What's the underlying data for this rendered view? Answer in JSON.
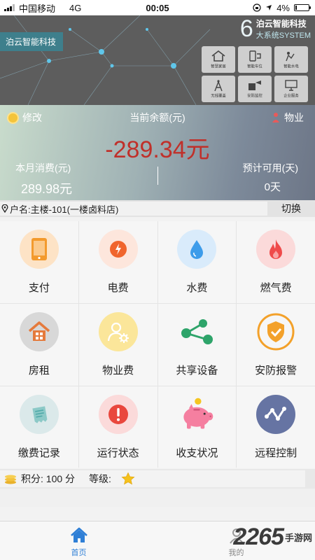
{
  "status_bar": {
    "carrier": "中国移动",
    "network": "4G",
    "time": "00:05",
    "battery": "4%"
  },
  "banner": {
    "tag": "泊云智能科技",
    "brand_number": "6",
    "brand_name": "泊云智能科技",
    "brand_sub": "大系统SYSTEM",
    "tiles": [
      {
        "label": "智慧家居",
        "icon": "house-icon"
      },
      {
        "label": "智能车位",
        "icon": "parking-phone-icon"
      },
      {
        "label": "智能水电",
        "icon": "water-power-icon"
      },
      {
        "label": "无线覆盖",
        "icon": "wireless-tower-icon"
      },
      {
        "label": "安防监控",
        "icon": "camera-icon"
      },
      {
        "label": "企业服务",
        "icon": "computer-icon"
      }
    ]
  },
  "balance": {
    "edit_label": "修改",
    "current_label": "当前余额(元)",
    "amount": "-289.34元",
    "property_label": "物业",
    "month_label": "本月消费(元)",
    "month_value": "289.98元",
    "available_label": "预计可用(天)",
    "available_value": "0天"
  },
  "account": {
    "name": "户名:主楼-101(一楼卤料店)",
    "switch_label": "切换"
  },
  "grid": [
    {
      "label": "支付",
      "icon": "phone-payment-icon",
      "bg": "#fde3c6",
      "fg": "#f39a2d"
    },
    {
      "label": "电费",
      "icon": "lightning-icon",
      "bg": "#fde6dc",
      "fg": "#f0652d"
    },
    {
      "label": "水费",
      "icon": "water-drop-icon",
      "bg": "#d9ebfb",
      "fg": "#3d9cea"
    },
    {
      "label": "燃气费",
      "icon": "flame-icon",
      "bg": "#fbdada",
      "fg": "#ef4b4b"
    },
    {
      "label": "房租",
      "icon": "house-rent-icon",
      "bg": "#d8d8d8",
      "fg": "#e57a3c"
    },
    {
      "label": "物业费",
      "icon": "user-gear-icon",
      "bg": "#fbe69a",
      "fg": "#ffffff"
    },
    {
      "label": "共享设备",
      "icon": "share-icon",
      "bg": "transparent",
      "fg": "#2ea46a"
    },
    {
      "label": "安防报警",
      "icon": "shield-check-icon",
      "bg": "transparent",
      "fg": "#f3a12a"
    },
    {
      "label": "缴费记录",
      "icon": "receipt-icon",
      "bg": "#dbe9ea",
      "fg": "#4fa9a8"
    },
    {
      "label": "运行状态",
      "icon": "alert-icon",
      "bg": "#fbdada",
      "fg": "#e9473d"
    },
    {
      "label": "收支状况",
      "icon": "piggy-bank-icon",
      "bg": "transparent",
      "fg": "#f57fa0"
    },
    {
      "label": "远程控制",
      "icon": "remote-chart-icon",
      "bg": "#6674a3",
      "fg": "#ffffff"
    }
  ],
  "points": {
    "label": "积分: 100 分",
    "level_label": "等级:"
  },
  "tabbar": {
    "home": "首页",
    "mine": "我的"
  },
  "watermark": {
    "number": "2265",
    "suffix_top": "手游网",
    "suffix_bottom": ""
  }
}
